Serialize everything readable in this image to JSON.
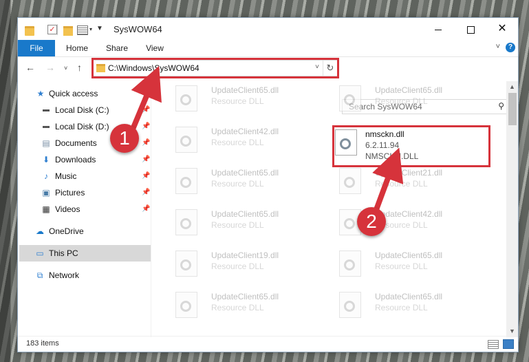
{
  "window": {
    "title": "SysWOW64",
    "controls": {
      "minimize": "—",
      "maximize": "□",
      "close": "✕"
    }
  },
  "ribbon": {
    "tabs": [
      "File",
      "Home",
      "Share",
      "View"
    ],
    "help": "?"
  },
  "address": {
    "path": "C:\\Windows\\SysWOW64",
    "search_placeholder": "Search SysWOW64"
  },
  "sidebar": {
    "items": [
      {
        "label": "Quick access",
        "icon": "star-icon",
        "pinned": false
      },
      {
        "label": "Local Disk (C:)",
        "icon": "drive-icon",
        "pinned": true
      },
      {
        "label": "Local Disk (D:)",
        "icon": "drive-icon",
        "pinned": true
      },
      {
        "label": "Documents",
        "icon": "documents-icon",
        "pinned": true
      },
      {
        "label": "Downloads",
        "icon": "download-icon",
        "pinned": true
      },
      {
        "label": "Music",
        "icon": "music-icon",
        "pinned": true
      },
      {
        "label": "Pictures",
        "icon": "pictures-icon",
        "pinned": true
      },
      {
        "label": "Videos",
        "icon": "videos-icon",
        "pinned": true
      },
      {
        "label": "OneDrive",
        "icon": "cloud-icon",
        "pinned": false
      },
      {
        "label": "This PC",
        "icon": "computer-icon",
        "pinned": false,
        "selected": true
      },
      {
        "label": "Network",
        "icon": "network-icon",
        "pinned": false
      }
    ]
  },
  "files": [
    {
      "name": "UpdateClient65.dll",
      "type": "Resource DLL"
    },
    {
      "name": "UpdateClient65.dll",
      "type": "Resource DLL"
    },
    {
      "name": "UpdateClient42.dll",
      "type": "Resource DLL"
    },
    {
      "name": "nmsckn.dll",
      "version": "6.2.11.94",
      "type": "NMSCKN.DLL",
      "highlighted": true
    },
    {
      "name": "UpdateClient65.dll",
      "type": "Resource DLL"
    },
    {
      "name": "UpdateClient21.dll",
      "type": "Resource DLL"
    },
    {
      "name": "UpdateClient65.dll",
      "type": "Resource DLL"
    },
    {
      "name": "UpdateClient42.dll",
      "type": "Resource DLL"
    },
    {
      "name": "UpdateClient19.dll",
      "type": "Resource DLL"
    },
    {
      "name": "UpdateClient65.dll",
      "type": "Resource DLL"
    },
    {
      "name": "UpdateClient65.dll",
      "type": "Resource DLL"
    },
    {
      "name": "UpdateClient65.dll",
      "type": "Resource DLL"
    },
    {
      "name": "",
      "type": ""
    },
    {
      "name": "",
      "type": ""
    }
  ],
  "status": {
    "item_count": "183 items"
  },
  "callouts": [
    "1",
    "2"
  ],
  "colors": {
    "accent": "#1979ca",
    "highlight": "#d6333b"
  }
}
